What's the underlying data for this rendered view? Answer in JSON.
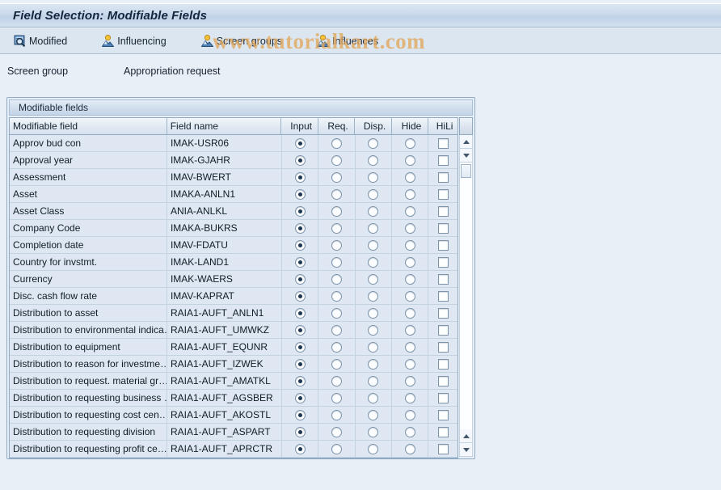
{
  "window": {
    "title": "Field Selection: Modifiable Fields"
  },
  "watermark": {
    "text": "www.tutorialkart.com",
    "color": "#e2a85c"
  },
  "toolbar": {
    "buttons": [
      {
        "label": "Modified",
        "icon": "magnifier-document-icon"
      },
      {
        "label": "Influencing",
        "icon": "person-group-icon"
      },
      {
        "label": "Screen groups",
        "icon": "person-group-icon"
      },
      {
        "label": "Influences",
        "icon": "person-group-icon"
      }
    ]
  },
  "screen_group": {
    "label": "Screen group",
    "value": "Appropriation request"
  },
  "panel": {
    "caption": "Modifiable fields"
  },
  "grid": {
    "columns": [
      {
        "key": "name",
        "label": "Modifiable field"
      },
      {
        "key": "field",
        "label": "Field name"
      },
      {
        "key": "input",
        "label": "Input"
      },
      {
        "key": "req",
        "label": "Req."
      },
      {
        "key": "disp",
        "label": "Disp."
      },
      {
        "key": "hide",
        "label": "Hide"
      },
      {
        "key": "hili",
        "label": "HiLi"
      },
      {
        "key": "sel",
        "label": ""
      }
    ],
    "rows": [
      {
        "name": "Approv bud con",
        "field": "IMAK-USR06",
        "input": true,
        "req": false,
        "disp": false,
        "hide": false,
        "hili": false
      },
      {
        "name": "Approval year",
        "field": "IMAK-GJAHR",
        "input": true,
        "req": false,
        "disp": false,
        "hide": false,
        "hili": false
      },
      {
        "name": "Assessment",
        "field": "IMAV-BWERT",
        "input": true,
        "req": false,
        "disp": false,
        "hide": false,
        "hili": false
      },
      {
        "name": "Asset",
        "field": "IMAKA-ANLN1",
        "input": true,
        "req": false,
        "disp": false,
        "hide": false,
        "hili": false
      },
      {
        "name": "Asset Class",
        "field": "ANIA-ANLKL",
        "input": true,
        "req": false,
        "disp": false,
        "hide": false,
        "hili": false
      },
      {
        "name": "Company Code",
        "field": "IMAKA-BUKRS",
        "input": true,
        "req": false,
        "disp": false,
        "hide": false,
        "hili": false
      },
      {
        "name": "Completion date",
        "field": "IMAV-FDATU",
        "input": true,
        "req": false,
        "disp": false,
        "hide": false,
        "hili": false
      },
      {
        "name": "Country for invstmt.",
        "field": "IMAK-LAND1",
        "input": true,
        "req": false,
        "disp": false,
        "hide": false,
        "hili": false
      },
      {
        "name": "Currency",
        "field": "IMAK-WAERS",
        "input": true,
        "req": false,
        "disp": false,
        "hide": false,
        "hili": false
      },
      {
        "name": "Disc. cash flow rate",
        "field": "IMAV-KAPRAT",
        "input": true,
        "req": false,
        "disp": false,
        "hide": false,
        "hili": false
      },
      {
        "name": "Distribution to asset",
        "field": "RAIA1-AUFT_ANLN1",
        "input": true,
        "req": false,
        "disp": false,
        "hide": false,
        "hili": false
      },
      {
        "name": "Distribution to environmental indica…",
        "field": "RAIA1-AUFT_UMWKZ",
        "input": true,
        "req": false,
        "disp": false,
        "hide": false,
        "hili": false
      },
      {
        "name": "Distribution to equipment",
        "field": "RAIA1-AUFT_EQUNR",
        "input": true,
        "req": false,
        "disp": false,
        "hide": false,
        "hili": false
      },
      {
        "name": "Distribution to reason for investme…",
        "field": "RAIA1-AUFT_IZWEK",
        "input": true,
        "req": false,
        "disp": false,
        "hide": false,
        "hili": false
      },
      {
        "name": "Distribution to request. material gr…",
        "field": "RAIA1-AUFT_AMATKL",
        "input": true,
        "req": false,
        "disp": false,
        "hide": false,
        "hili": false
      },
      {
        "name": "Distribution to requesting business …",
        "field": "RAIA1-AUFT_AGSBER",
        "input": true,
        "req": false,
        "disp": false,
        "hide": false,
        "hili": false
      },
      {
        "name": "Distribution to requesting cost cen…",
        "field": "RAIA1-AUFT_AKOSTL",
        "input": true,
        "req": false,
        "disp": false,
        "hide": false,
        "hili": false
      },
      {
        "name": "Distribution to requesting division",
        "field": "RAIA1-AUFT_ASPART",
        "input": true,
        "req": false,
        "disp": false,
        "hide": false,
        "hili": false
      },
      {
        "name": "Distribution to requesting profit ce…",
        "field": "RAIA1-AUFT_APRCTR",
        "input": true,
        "req": false,
        "disp": false,
        "hide": false,
        "hili": false
      }
    ]
  }
}
